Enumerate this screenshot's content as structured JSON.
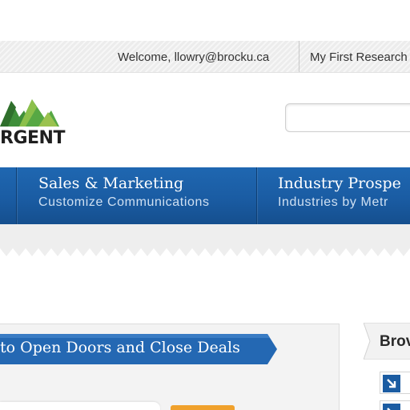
{
  "header": {
    "welcome_text": "Welcome, llowry@brocku.ca",
    "my_research_link": "My First Research"
  },
  "logo": {
    "wordmark": "RGENT"
  },
  "search": {
    "placeholder": "",
    "value": ""
  },
  "nav": {
    "items": [
      {
        "title": "Sales & Marketing",
        "subtitle": "Customize Communications"
      },
      {
        "title": "Industry Prospe",
        "subtitle": "Industries by Metr"
      }
    ]
  },
  "main": {
    "banner_text": "to Open Doors and Close Deals"
  },
  "browse": {
    "heading": "Brov",
    "items": [
      {
        "icon": "arrow-down-right-icon",
        "label": ""
      },
      {
        "icon": "arrow-down-right-icon",
        "label": ""
      }
    ]
  },
  "colors": {
    "nav_blue": "#1a5ca3",
    "ribbon_blue": "#2468b3",
    "accent_orange": "#f0a12c",
    "logo_green": "#3f8f3a"
  }
}
